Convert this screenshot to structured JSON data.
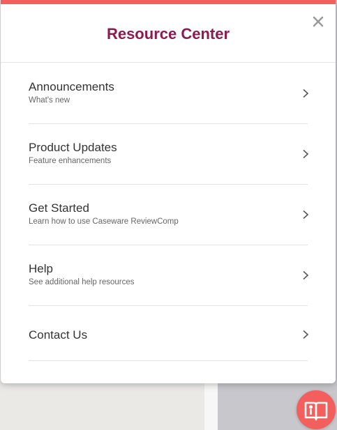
{
  "panel": {
    "title": "Resource Center",
    "accent_color": "#f25f5c",
    "title_color": "#8c1b52",
    "close_icon": "close-icon"
  },
  "menu": {
    "items": [
      {
        "title": "Announcements",
        "subtitle": "What's new",
        "icon": "chevron-right-icon"
      },
      {
        "title": "Product Updates",
        "subtitle": "Feature enhancements",
        "icon": "chevron-right-icon"
      },
      {
        "title": "Get Started",
        "subtitle": "Learn how to use Caseware ReviewComp",
        "icon": "chevron-right-icon"
      },
      {
        "title": "Help",
        "subtitle": "See additional help resources",
        "icon": "chevron-right-icon"
      },
      {
        "title": "Contact Us",
        "subtitle": "",
        "icon": "chevron-right-icon"
      }
    ]
  },
  "launcher": {
    "icon": "open-book-icon",
    "color": "#f25f5c"
  }
}
